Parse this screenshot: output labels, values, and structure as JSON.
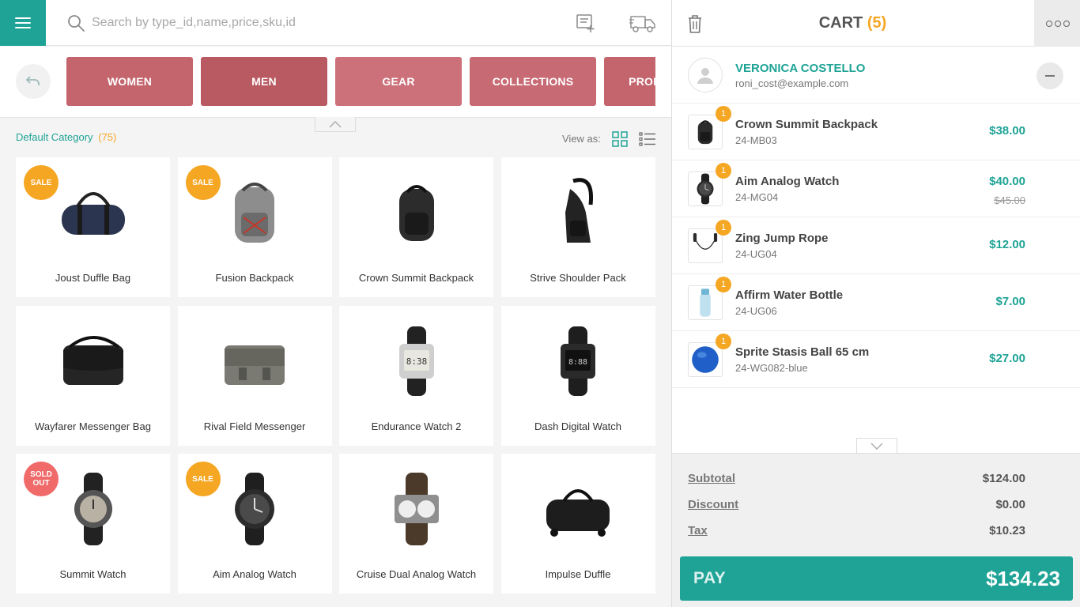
{
  "search": {
    "placeholder": "Search by type_id,name,price,sku,id"
  },
  "categories": [
    {
      "label": "WOMEN",
      "color": "#c4656e"
    },
    {
      "label": "MEN",
      "color": "#b95a63"
    },
    {
      "label": "GEAR",
      "color": "#cc7079"
    },
    {
      "label": "COLLECTIONS",
      "color": "#c86a74"
    },
    {
      "label": "PROMOTIONS",
      "color": "#c4656e"
    }
  ],
  "breadcrumb": {
    "label": "Default Category",
    "count": "(75)"
  },
  "view_as": "View as:",
  "products": [
    {
      "name": "Joust Duffle Bag",
      "badge": "SALE",
      "badge_type": "sale",
      "icon": "duffle-bag"
    },
    {
      "name": "Fusion Backpack",
      "badge": "SALE",
      "badge_type": "sale",
      "icon": "backpack-gray"
    },
    {
      "name": "Crown Summit Backpack",
      "badge": "",
      "badge_type": "",
      "icon": "backpack-black"
    },
    {
      "name": "Strive Shoulder Pack",
      "badge": "",
      "badge_type": "",
      "icon": "shoulder-pack"
    },
    {
      "name": "Wayfarer Messenger Bag",
      "badge": "",
      "badge_type": "",
      "icon": "messenger-black"
    },
    {
      "name": "Rival Field Messenger",
      "badge": "",
      "badge_type": "",
      "icon": "messenger-gray"
    },
    {
      "name": "Endurance Watch 2",
      "badge": "",
      "badge_type": "",
      "icon": "digital-watch-silver"
    },
    {
      "name": "Dash Digital Watch",
      "badge": "",
      "badge_type": "",
      "icon": "digital-watch-black"
    },
    {
      "name": "Summit Watch",
      "badge": "SOLD OUT",
      "badge_type": "sold",
      "icon": "sport-watch"
    },
    {
      "name": "Aim Analog Watch",
      "badge": "SALE",
      "badge_type": "sale",
      "icon": "analog-watch"
    },
    {
      "name": "Cruise Dual Analog Watch",
      "badge": "",
      "badge_type": "",
      "icon": "dual-watch"
    },
    {
      "name": "Impulse Duffle",
      "badge": "",
      "badge_type": "",
      "icon": "rolling-duffle"
    }
  ],
  "cart": {
    "title": "CART",
    "count": "(5)",
    "customer": {
      "name": "VERONICA COSTELLO",
      "email": "roni_cost@example.com"
    },
    "items": [
      {
        "name": "Crown Summit Backpack",
        "sku": "24-MB03",
        "qty": "1",
        "price": "$38.00",
        "original_price": "",
        "icon": "backpack-black"
      },
      {
        "name": "Aim Analog Watch",
        "sku": "24-MG04",
        "qty": "1",
        "price": "$40.00",
        "original_price": "$45.00",
        "icon": "analog-watch"
      },
      {
        "name": "Zing Jump Rope",
        "sku": "24-UG04",
        "qty": "1",
        "price": "$12.00",
        "original_price": "",
        "icon": "jump-rope"
      },
      {
        "name": "Affirm Water Bottle",
        "sku": "24-UG06",
        "qty": "1",
        "price": "$7.00",
        "original_price": "",
        "icon": "water-bottle"
      },
      {
        "name": "Sprite Stasis Ball 65 cm",
        "sku": "24-WG082-blue",
        "qty": "1",
        "price": "$27.00",
        "original_price": "",
        "icon": "blue-ball"
      }
    ],
    "totals": [
      {
        "label": "Subtotal",
        "value": "$124.00"
      },
      {
        "label": "Discount",
        "value": "$0.00"
      },
      {
        "label": "Tax",
        "value": "$10.23"
      }
    ],
    "pay_label": "PAY",
    "pay_total": "$134.23"
  },
  "colors": {
    "accent": "#1fa396",
    "badge_sale": "#f5a623",
    "badge_sold": "#f06a6a",
    "count": "#f5a623"
  }
}
